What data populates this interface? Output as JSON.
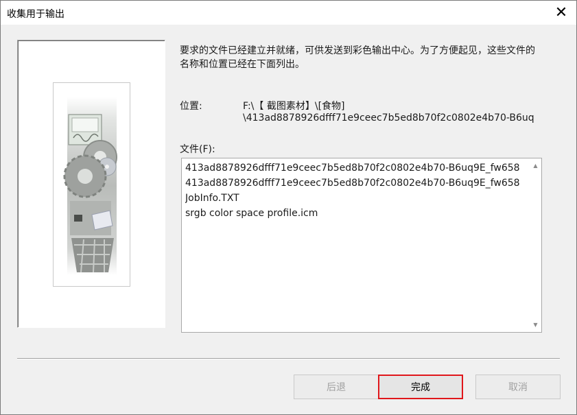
{
  "window": {
    "title": "收集用于输出",
    "close_glyph": "✕"
  },
  "description": "要求的文件已经建立并就绪，可供发送到彩色输出中心。为了方便起见，这些文件的名称和位置已经在下面列出。",
  "location": {
    "label": "位置:",
    "line1": "F:\\【 截图素材】\\[食物]",
    "line2": "\\413ad8878926dfff71e9ceec7b5ed8b70f2c0802e4b70-B6uq"
  },
  "files": {
    "label": "文件(F):",
    "items": [
      "413ad8878926dfff71e9ceec7b5ed8b70f2c0802e4b70-B6uq9E_fw658",
      "413ad8878926dfff71e9ceec7b5ed8b70f2c0802e4b70-B6uq9E_fw658",
      "JobInfo.TXT",
      "srgb color space profile.icm"
    ]
  },
  "buttons": {
    "back": "后退",
    "finish": "完成",
    "cancel": "取消"
  },
  "colors": {
    "default_button_border": "#e0161a"
  }
}
